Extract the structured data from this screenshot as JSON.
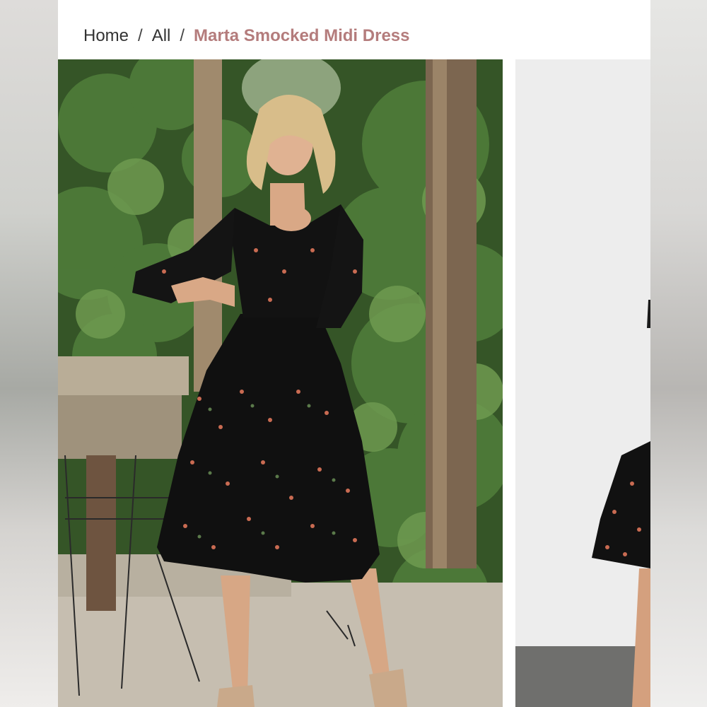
{
  "breadcrumb": {
    "home": "Home",
    "all": "All",
    "current": "Marta Smocked Midi Dress",
    "separator": "/"
  },
  "gallery": {
    "images": [
      {
        "name": "product-photo-1",
        "alt": "Model wearing black floral smocked midi dress outdoors in garden"
      },
      {
        "name": "product-photo-2",
        "alt": "Model wearing dress against white studio wall"
      }
    ]
  },
  "colors": {
    "accent": "#b47c7c",
    "text": "#333333",
    "dress": "#101010",
    "floral": "#c96b52",
    "foliage": "#3d6a2e"
  }
}
